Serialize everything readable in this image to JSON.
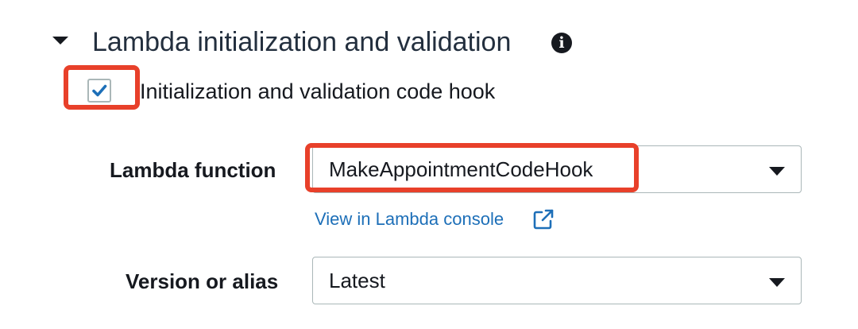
{
  "section": {
    "title": "Lambda initialization and validation",
    "info_icon": "info-icon",
    "collapse_icon": "caret-down-icon"
  },
  "hook_checkbox": {
    "label": "Initialization and validation code hook",
    "checked": true
  },
  "lambda_function": {
    "label": "Lambda function",
    "value": "MakeAppointmentCodeHook",
    "dropdown_icon": "caret-down-icon"
  },
  "console_link": {
    "text": "View in Lambda console",
    "icon": "external-link-icon"
  },
  "version": {
    "label": "Version or alias",
    "value": "Latest",
    "dropdown_icon": "caret-down-icon"
  },
  "colors": {
    "highlight": "#e8402a",
    "link": "#1d6fb8",
    "check": "#1d6fb8",
    "text": "#16191f"
  }
}
